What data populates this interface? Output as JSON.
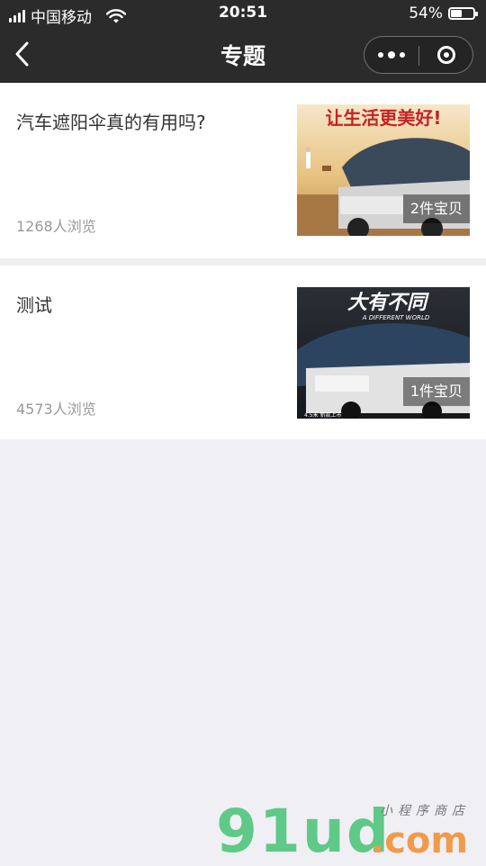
{
  "status_bar": {
    "carrier": "中国移动",
    "time": "20:51",
    "battery_percent": "54%",
    "battery_level": 0.54
  },
  "nav": {
    "title": "专题"
  },
  "topics": [
    {
      "title": "汽车遮阳伞真的有用吗?",
      "views": "1268人浏览",
      "item_count": "2件宝贝",
      "thumb_slogan": "让生活更美好!"
    },
    {
      "title": "测试",
      "views": "4573人浏览",
      "item_count": "1件宝贝",
      "thumb_slogan": "大有不同",
      "thumb_subtitle": "A DIFFERENT WORLD",
      "thumb_caption": "4.5米 新款上市"
    }
  ],
  "watermark": {
    "logo": "91ud",
    "domain": ".com",
    "subtitle": "小程序商店"
  }
}
